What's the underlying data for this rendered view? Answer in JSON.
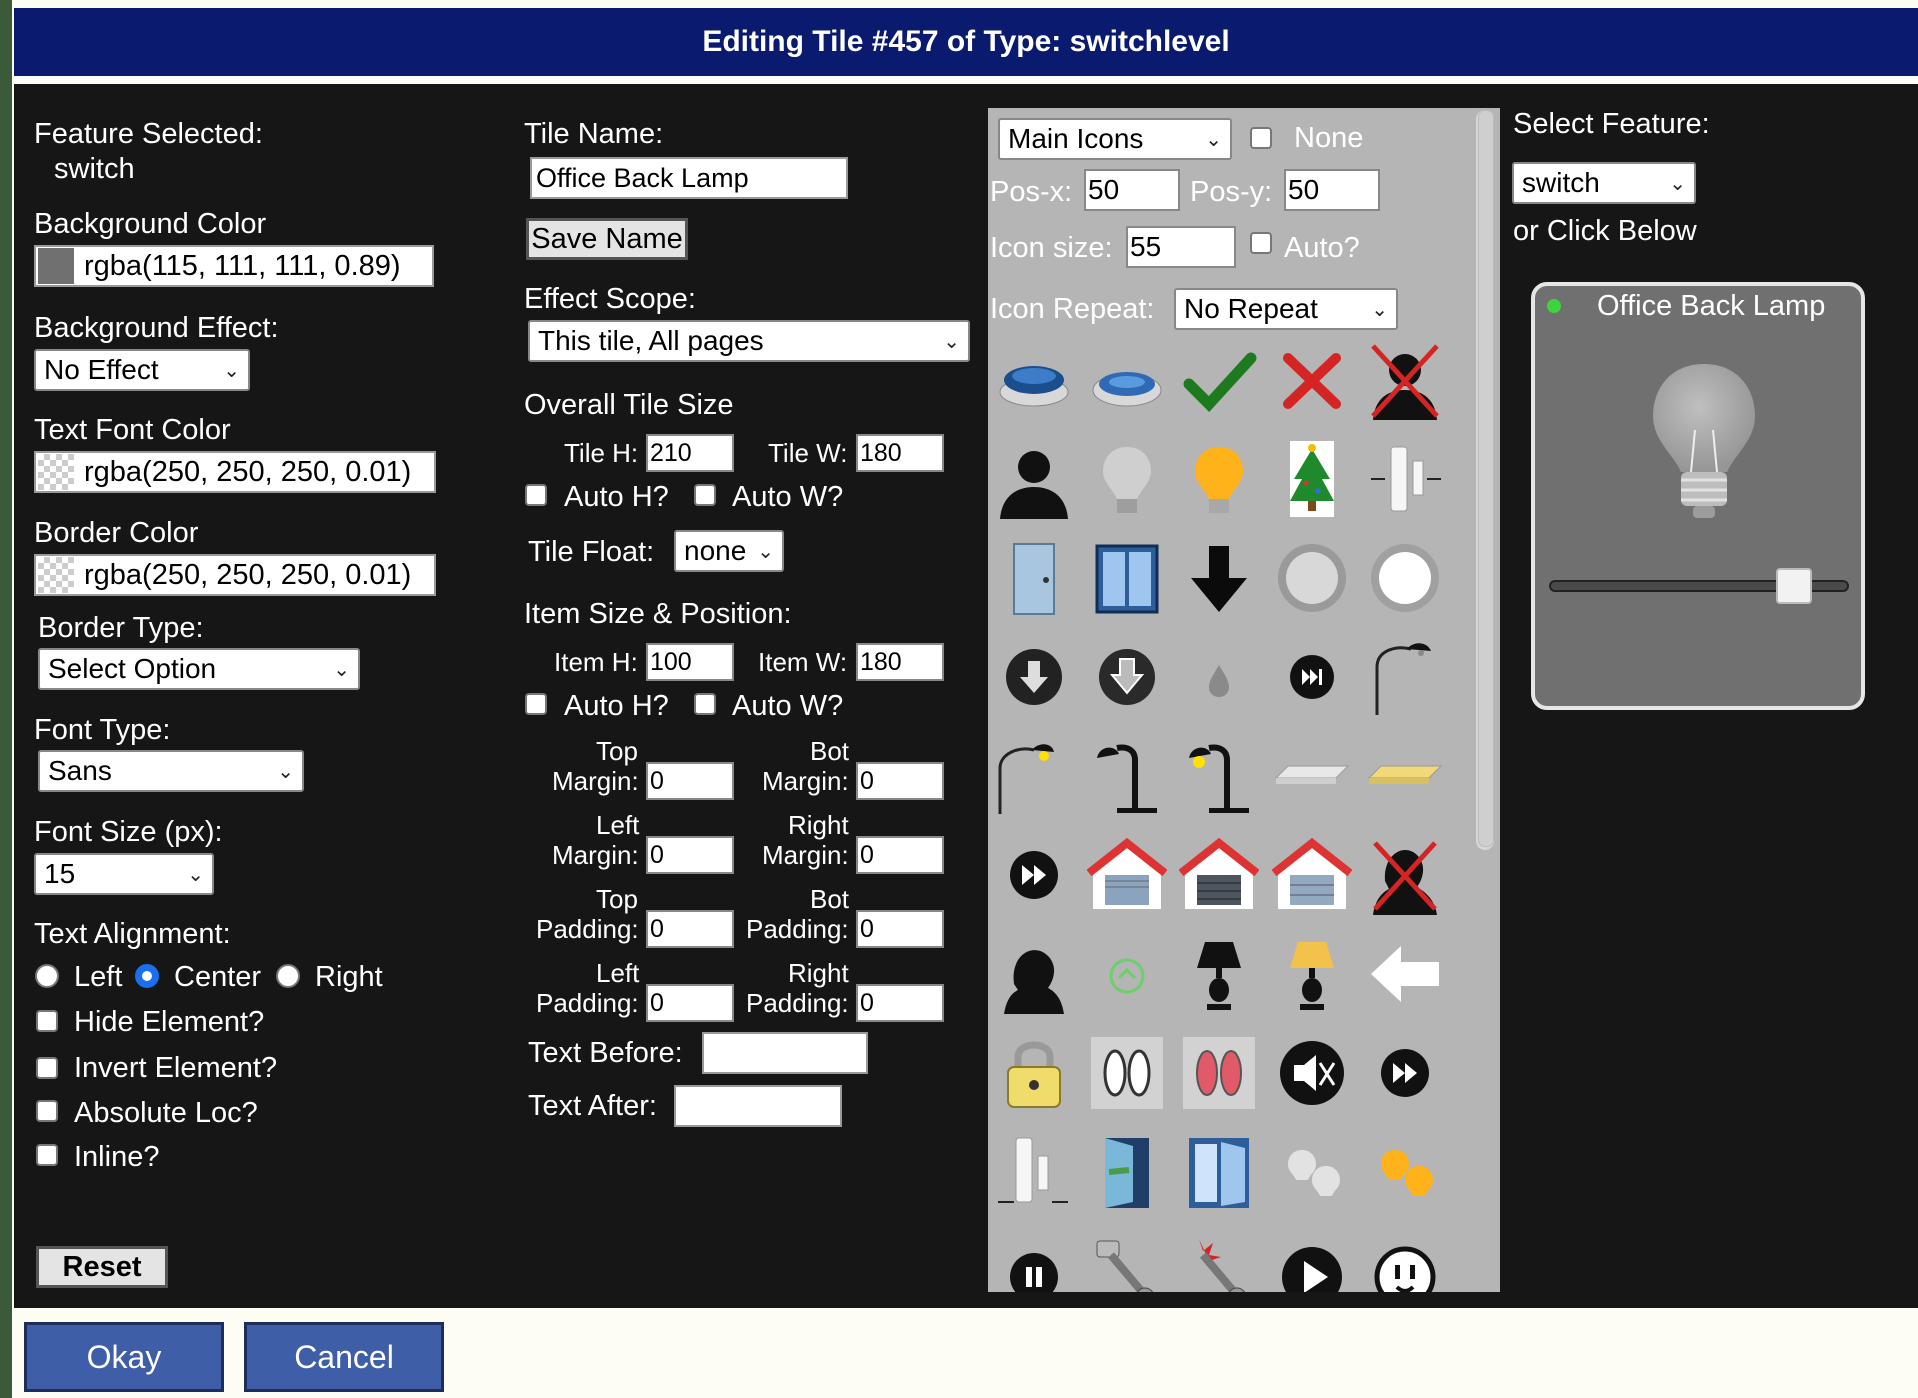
{
  "title": "Editing Tile #457 of Type: switchlevel",
  "left": {
    "feature_selected_label": "Feature Selected:",
    "feature_selected_value": "switch",
    "bg_color_label": "Background Color",
    "bg_color_value": "rgba(115, 111, 111, 0.89)",
    "bg_effect_label": "Background Effect:",
    "bg_effect_value": "No Effect",
    "text_color_label": "Text Font Color",
    "text_color_value": "rgba(250, 250, 250, 0.01)",
    "border_color_label": "Border Color",
    "border_color_value": "rgba(250, 250, 250, 0.01)",
    "border_type_label": "Border Type:",
    "border_type_value": "Select Option",
    "font_type_label": "Font Type:",
    "font_type_value": "Sans",
    "font_size_label": "Font Size (px):",
    "font_size_value": "15",
    "text_align_label": "Text Alignment:",
    "align_left": "Left",
    "align_center": "Center",
    "align_right": "Right",
    "hide_label": "Hide Element?",
    "invert_label": "Invert Element?",
    "absolute_label": "Absolute Loc?",
    "inline_label": "Inline?",
    "reset_label": "Reset"
  },
  "middle": {
    "tile_name_label": "Tile Name:",
    "tile_name_value": "Office Back Lamp",
    "save_name_label": "Save Name",
    "effect_scope_label": "Effect Scope:",
    "effect_scope_value": "This tile, All pages",
    "overall_size_label": "Overall Tile Size",
    "tile_h_label": "Tile H:",
    "tile_h_value": "210",
    "tile_w_label": "Tile W:",
    "tile_w_value": "180",
    "auto_h_label": "Auto H?",
    "auto_w_label": "Auto W?",
    "tile_float_label": "Tile Float:",
    "tile_float_value": "none",
    "item_size_label": "Item Size & Position:",
    "item_h_label": "Item H:",
    "item_h_value": "100",
    "item_w_label": "Item W:",
    "item_w_value": "180",
    "item_auto_h_label": "Auto H?",
    "item_auto_w_label": "Auto W?",
    "top_label": "Top",
    "bot_label": "Bot",
    "left_label": "Left",
    "right_label": "Right",
    "margin_label": "Margin:",
    "padding_label": "Padding:",
    "top_margin_value": "0",
    "bot_margin_value": "0",
    "left_margin_value": "0",
    "right_margin_value": "0",
    "top_padding_value": "0",
    "bot_padding_value": "0",
    "left_padding_value": "0",
    "right_padding_value": "0",
    "text_before_label": "Text Before:",
    "text_before_value": "",
    "text_after_label": "Text After:",
    "text_after_value": ""
  },
  "icons": {
    "set_value": "Main Icons",
    "none_label": "None",
    "posx_label": "Pos-x:",
    "posx_value": "50",
    "posy_label": "Pos-y:",
    "posy_value": "50",
    "icon_size_label": "Icon size:",
    "icon_size_value": "55",
    "auto_label": "Auto?",
    "repeat_label": "Icon Repeat:",
    "repeat_value": "No Repeat",
    "grid": [
      [
        "blue-button-icon",
        "blue-button-pressed-icon",
        "checkmark-icon",
        "red-x-icon",
        "person-crossed-icon"
      ],
      [
        "man-silhouette-icon",
        "bulb-off-icon",
        "bulb-on-icon",
        "christmas-tree-icon",
        "contact-sensor-icon"
      ],
      [
        "door-icon",
        "window-icon",
        "down-arrow-icon",
        "ceiling-light-off-icon",
        "ceiling-light-on-icon"
      ],
      [
        "down-circle-icon",
        "down-circle-alt-icon",
        "water-drop-icon",
        "skip-icon",
        "arc-lamp-icon"
      ],
      [
        "arc-lamp-on-icon",
        "desk-lamp-icon",
        "desk-lamp-on-icon",
        "fixture-off-icon",
        "fixture-on-icon"
      ],
      [
        "fast-forward-icon",
        "garage-open-icon",
        "garage-closed-icon",
        "garage-half-icon",
        "woman-crossed-icon"
      ],
      [
        "woman-silhouette-icon",
        "home-eco-icon",
        "table-lamp-icon",
        "table-lamp-on-icon",
        "left-arrow-icon"
      ],
      [
        "padlock-icon",
        "footprints-icon",
        "footprints-red-icon",
        "mute-icon",
        "forward-icon"
      ],
      [
        "contact-open-icon",
        "door-open-icon",
        "window-open-icon",
        "bulbs-off-icon",
        "bulbs-on-icon"
      ],
      [
        "pause-icon",
        "piston-icon",
        "piston-broken-icon",
        "play-icon",
        "outlet-icon"
      ]
    ]
  },
  "right": {
    "select_feature_label": "Select Feature:",
    "select_feature_value": "switch",
    "or_click_label": "or Click Below",
    "preview_name": "Office Back Lamp",
    "preview_level": 0.86
  },
  "footer": {
    "okay_label": "Okay",
    "cancel_label": "Cancel"
  }
}
